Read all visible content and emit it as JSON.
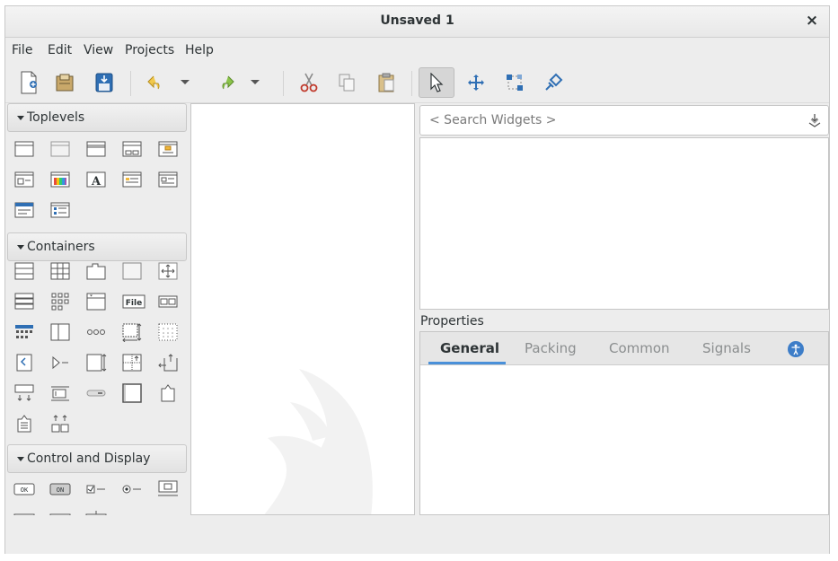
{
  "window": {
    "title": "Unsaved 1",
    "close_glyph": "×"
  },
  "menu": [
    "File",
    "Edit",
    "View",
    "Projects",
    "Help"
  ],
  "toolbar": {
    "buttons": [
      "new-icon",
      "open-icon",
      "save-icon",
      "undo-icon",
      "undo-dropdown-icon",
      "redo-icon",
      "redo-dropdown-icon",
      "cut-icon",
      "copy-icon",
      "paste-icon",
      "select-pointer-icon",
      "drag-resize-icon",
      "margin-edit-icon",
      "alignment-edit-icon"
    ],
    "selected": "select-pointer-icon"
  },
  "palette": {
    "groups": [
      {
        "name": "Toplevels",
        "expanded": true
      },
      {
        "name": "Containers",
        "expanded": true
      },
      {
        "name": "Control and Display",
        "expanded": true
      }
    ],
    "file_chooser_label": "File",
    "button_label": "OK",
    "toggle_label": "ON"
  },
  "search": {
    "placeholder": "< Search Widgets >"
  },
  "properties": {
    "label": "Properties",
    "tabs": [
      "General",
      "Packing",
      "Common",
      "Signals"
    ],
    "active_tab": "General"
  },
  "colors": {
    "accent": "#4a90d9",
    "a11y_badge": "#3d7dc8",
    "icon_blue": "#2f6fb4"
  }
}
